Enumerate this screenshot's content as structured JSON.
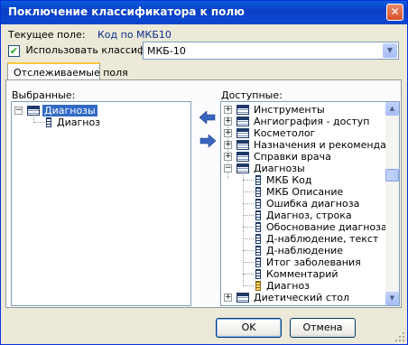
{
  "window": {
    "title": "Поключение классификатора к полю",
    "close_glyph": "✕"
  },
  "current_field": {
    "label": "Текущее поле:",
    "value": "Код по МКБ10"
  },
  "classifier": {
    "checked": true,
    "check_glyph": "✔",
    "label": "Использовать классификатор:",
    "selected": "МКБ-10"
  },
  "tab": {
    "label": "Отслеживаемые поля"
  },
  "selected_panel": {
    "label": "Выбранные:",
    "root": {
      "label": "Диагнозы",
      "expander": "−"
    },
    "children": [
      {
        "label": "Диагноз"
      }
    ]
  },
  "available_panel": {
    "label": "Доступные:",
    "collapsed": [
      {
        "label": "Инструменты",
        "expander": "+"
      },
      {
        "label": "Ангиография - доступ",
        "expander": "+"
      },
      {
        "label": "Косметолог",
        "expander": "+"
      },
      {
        "label": "Назначения и рекомендации",
        "expander": "+"
      },
      {
        "label": "Справки врача",
        "expander": "+"
      }
    ],
    "expanded": {
      "label": "Диагнозы",
      "expander": "−"
    },
    "fields": [
      {
        "label": "МКБ Код",
        "icon": "field-icon"
      },
      {
        "label": "МКБ Описание",
        "icon": "field-icon"
      },
      {
        "label": "Ошибка диагноза",
        "icon": "field-icon"
      },
      {
        "label": "Диагноз, строка",
        "icon": "field-icon"
      },
      {
        "label": "Обоснование диагноза",
        "icon": "field-icon"
      },
      {
        "label": "Д-наблюдение, текст",
        "icon": "field-icon"
      },
      {
        "label": "Д-наблюдение",
        "icon": "field-icon"
      },
      {
        "label": "Итог заболевания",
        "icon": "field-icon"
      },
      {
        "label": "Комментарий",
        "icon": "field-icon"
      },
      {
        "label": "Диагноз",
        "icon": "field-icon-yellow"
      }
    ],
    "partial_next": {
      "label": "Диетический стол",
      "expander": "+"
    }
  },
  "buttons": {
    "ok": "OK",
    "cancel": "Отмена"
  },
  "colors": {
    "titlebar": "#0A3FC4",
    "selection": "#316AC5",
    "arrow": "#3A64C0",
    "face": "#ECE9D8"
  }
}
